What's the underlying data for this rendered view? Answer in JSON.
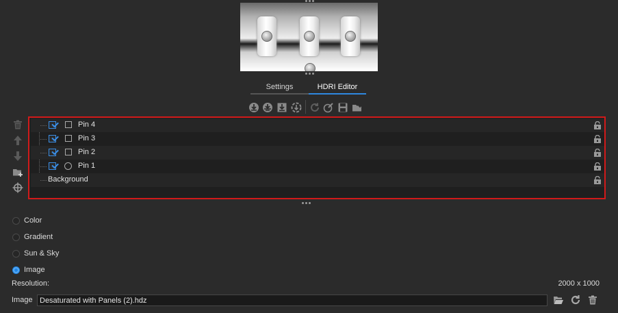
{
  "tabs": [
    {
      "label": "Settings",
      "active": false
    },
    {
      "label": "HDRI Editor",
      "active": true
    }
  ],
  "toolbar": {
    "icons": [
      "move-down-icon",
      "move-to-ground-icon",
      "place-bottom-icon",
      "reset-position-icon",
      "refresh-icon",
      "edit-icon",
      "save-icon",
      "open-folder-icon"
    ]
  },
  "side_toolbar": {
    "icons": [
      "trash-icon",
      "arrow-up-icon",
      "arrow-down-icon",
      "add-folder-icon",
      "crosshair-icon"
    ]
  },
  "layers": [
    {
      "label": "Pin 4",
      "checked": true,
      "shape": "square"
    },
    {
      "label": "Pin 3",
      "checked": true,
      "shape": "square"
    },
    {
      "label": "Pin 2",
      "checked": true,
      "shape": "square"
    },
    {
      "label": "Pin 1",
      "checked": true,
      "shape": "circle"
    },
    {
      "label": "Background",
      "checked": null,
      "shape": null
    }
  ],
  "background_type": {
    "options": [
      "Color",
      "Gradient",
      "Sun & Sky",
      "Image"
    ],
    "selected": "Image"
  },
  "resolution": {
    "label": "Resolution:",
    "value": "2000 x 1000"
  },
  "image": {
    "label": "Image",
    "value": "Desaturated with Panels (2).hdz"
  },
  "colors": {
    "accent": "#1f86e8",
    "highlight_border": "#d21a1a",
    "background": "#2b2b2b"
  }
}
